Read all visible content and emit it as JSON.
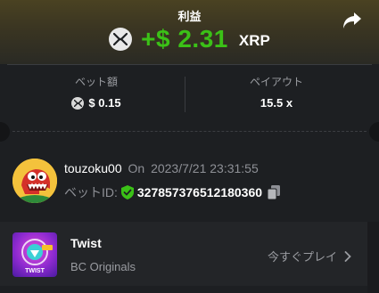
{
  "header": {
    "profit_label": "利益",
    "profit_amount": "+$ 2.31",
    "currency": "XRP",
    "accent_color": "#3bc117"
  },
  "stats": {
    "bet_amount_label": "ベット額",
    "bet_amount_value": "$ 0.15",
    "payout_label": "ペイアウト",
    "payout_value": "15.5 x"
  },
  "user": {
    "username": "touzoku00",
    "on_word": "On",
    "timestamp": "2023/7/21 23:31:55",
    "bet_id_label": "ベットID:",
    "bet_id": "327857376512180360"
  },
  "game": {
    "name": "Twist",
    "provider": "BC Originals",
    "play_label": "今すぐプレイ",
    "thumb_text": "TWIST"
  },
  "icons": [
    "xrp-coin-icon",
    "share-icon",
    "shield-check-icon",
    "copy-icon",
    "chevron-right-icon"
  ]
}
